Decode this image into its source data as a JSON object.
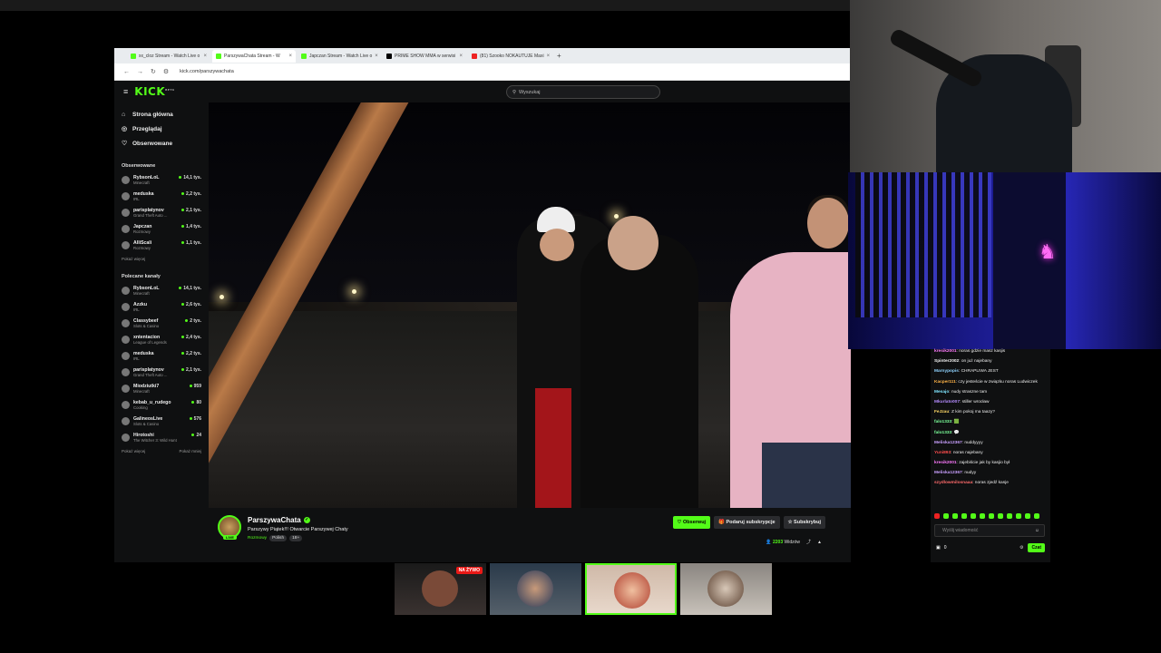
{
  "browser": {
    "tabs": [
      {
        "label": "xx_cloz Stream - Watch Live o",
        "icon": "kick-icon"
      },
      {
        "label": "ParszywaChata Stream - W",
        "icon": "kick-icon"
      },
      {
        "label": "Japczan Stream - Watch Live o",
        "icon": "kick-icon"
      },
      {
        "label": "PRIME SHOW MMA w serwisi",
        "icon": "x-icon"
      },
      {
        "label": "(81) Szooko NOKAUTUJE Maxi",
        "icon": "youtube-icon"
      }
    ],
    "url": "kick.com/parszywachata"
  },
  "kick": {
    "logo": "KICK",
    "logo_sup": "BETA",
    "search_placeholder": "Wyszukaj",
    "nav": [
      {
        "label": "Strona główna",
        "icon": "home-icon"
      },
      {
        "label": "Przeglądaj",
        "icon": "compass-icon"
      },
      {
        "label": "Obserwowane",
        "icon": "heart-icon"
      }
    ],
    "followed_title": "Obserwowane",
    "followed": [
      {
        "name": "RybsonLoL",
        "category": "Minecraft",
        "viewers": "14,1 tys."
      },
      {
        "name": "meduska",
        "category": "IRL",
        "viewers": "2,2 tys."
      },
      {
        "name": "parisplatynov",
        "category": "Grand Theft Auto ...",
        "viewers": "2,1 tys."
      },
      {
        "name": "Japczan",
        "category": "Rozmowy",
        "viewers": "1,4 tys."
      },
      {
        "name": "AlliScali",
        "category": "Rozmowy",
        "viewers": "1,1 tys."
      }
    ],
    "show_more": "Pokaż więcej",
    "show_less": "Pokaż mniej",
    "recommended_title": "Polecane kanały",
    "recommended": [
      {
        "name": "RybsonLoL",
        "category": "Minecraft",
        "viewers": "14,1 tys."
      },
      {
        "name": "Azzku",
        "category": "IRL",
        "viewers": "2,6 tys."
      },
      {
        "name": "Classybeef",
        "category": "Slots & Casino",
        "viewers": "2 tys."
      },
      {
        "name": "xntentacion",
        "category": "League of Legends",
        "viewers": "2,4 tys."
      },
      {
        "name": "meduska",
        "category": "IRL",
        "viewers": "2,2 tys."
      },
      {
        "name": "parisplatynov",
        "category": "Grand Theft Auto ...",
        "viewers": "2,1 tys."
      },
      {
        "name": "Miodziutki7",
        "category": "Minecraft",
        "viewers": "959"
      },
      {
        "name": "kebab_u_rudego",
        "category": "Cooking",
        "viewers": "80"
      },
      {
        "name": "GalineosLive",
        "category": "Slots & Casino",
        "viewers": "576"
      },
      {
        "name": "Hirotoshi",
        "category": "The Witcher 3: Wild Hunt",
        "viewers": "24"
      }
    ]
  },
  "stream": {
    "channel": "ParszywaChata",
    "title": "Parszywy Piątek!!! Otwarcie Parszywej Chaty",
    "category": "Rozmowy",
    "tags": [
      "Polish",
      "18+"
    ],
    "live_badge": "LIVE",
    "follow": "Obserwuj",
    "gift": "Podaruj subskrypcje",
    "subscribe": "Subskrybuj",
    "viewers": "2203",
    "viewers_label": "Widzów"
  },
  "chat": {
    "messages": [
      {
        "user": "kresik2001",
        "color": "#ff7bff",
        "text": "noras gdzie masz kasjis"
      },
      {
        "user": "Spinter2002",
        "color": "#f2f2f2",
        "text": "on już najebany"
      },
      {
        "user": "Marnypopis",
        "color": "#8fd3ff",
        "text": "CHRAPLIWA JEST"
      },
      {
        "user": "Kacper111",
        "color": "#ffb347",
        "text": "czy jesteście w związku noras Ludwiczek"
      },
      {
        "user": "Mesajo",
        "color": "#7fe5ff",
        "text": "nudy straszne tam"
      },
      {
        "user": "Mkurlato007",
        "color": "#b58cff",
        "text": "stiller wrocław"
      },
      {
        "user": "FeJzau",
        "color": "#ffd966",
        "text": "Z kim pokoj ma taazy?"
      },
      {
        "user": "falo1333",
        "color": "#7bff9a",
        "text": "🟩"
      },
      {
        "user": "falo1333",
        "color": "#7bff9a",
        "text": "💬"
      },
      {
        "user": "Meliska12367",
        "color": "#c9a0ff",
        "text": "nuddyyyy"
      },
      {
        "user": "Yuni893",
        "color": "#ff4d4d",
        "text": "noras najebany"
      },
      {
        "user": "kresik2001",
        "color": "#ff7bff",
        "text": "zajebiście jak by kasjio był"
      },
      {
        "user": "Meliska12367",
        "color": "#c9a0ff",
        "text": "nudyy"
      },
      {
        "user": "szydlowmilosnaaa",
        "color": "#ff6b6b",
        "text": "noras zjedź kasje"
      }
    ],
    "input_placeholder": "Wyślij wiadomość",
    "points": "0",
    "send": "Czat"
  },
  "switcher": {
    "live_label": "NA ŻYWO"
  }
}
